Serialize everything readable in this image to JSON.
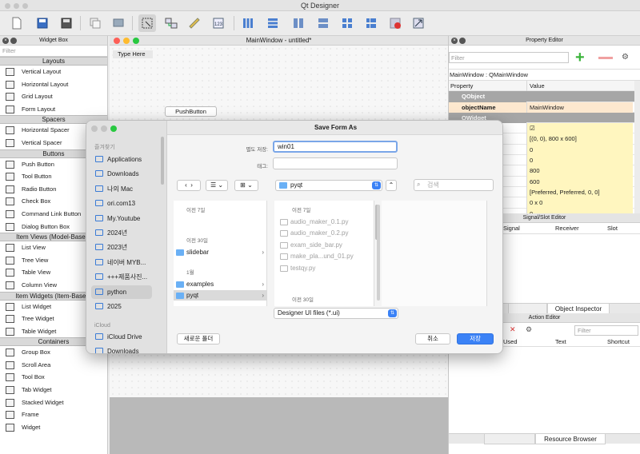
{
  "app": {
    "title": "Qt Designer"
  },
  "toolbar": {
    "buttons": [
      "new-form-icon",
      "save-icon",
      "save-as-icon",
      "copy-icon",
      "layers-icon",
      "edit-widgets-icon",
      "edit-signals-icon",
      "edit-buddies-icon",
      "edit-tab-order-icon",
      "lay-out-horizontally-icon",
      "lay-out-vertically-icon",
      "splitter-h-icon",
      "splitter-v-icon",
      "grid-layout-icon",
      "form-layout-icon",
      "break-layout-icon",
      "adjust-size-icon"
    ]
  },
  "widget_box": {
    "title": "Widget Box",
    "filter_placeholder": "Filter",
    "categories": [
      {
        "label": "Layouts",
        "items": [
          "Vertical Layout",
          "Horizontal Layout",
          "Grid Layout",
          "Form Layout"
        ]
      },
      {
        "label": "Spacers",
        "items": [
          "Horizontal Spacer",
          "Vertical Spacer"
        ]
      },
      {
        "label": "Buttons",
        "items": [
          "Push Button",
          "Tool Button",
          "Radio Button",
          "Check Box",
          "Command Link Button",
          "Dialog Button Box"
        ]
      },
      {
        "label": "Item Views (Model-Based)",
        "items": [
          "List View",
          "Tree View",
          "Table View",
          "Column View"
        ]
      },
      {
        "label": "Item Widgets (Item-Based)",
        "items": [
          "List Widget",
          "Tree Widget",
          "Table Widget"
        ]
      },
      {
        "label": "Containers",
        "items": [
          "Group Box",
          "Scroll Area",
          "Tool Box",
          "Tab Widget",
          "Stacked Widget",
          "Frame",
          "Widget"
        ]
      }
    ]
  },
  "form": {
    "title": "MainWindow - untitled*",
    "menubar_placeholder": "Type Here",
    "push_button": "PushButton"
  },
  "property_editor": {
    "title": "Property Editor",
    "filter_placeholder": "Filter",
    "object_label": "MainWindow : QMainWindow",
    "col_property": "Property",
    "col_value": "Value",
    "rows": [
      {
        "kind": "group",
        "name": "QObject",
        "value": ""
      },
      {
        "kind": "peach",
        "name": "objectName",
        "value": "MainWindow"
      },
      {
        "kind": "group",
        "name": "QWidget",
        "value": ""
      },
      {
        "kind": "yellow",
        "name": "",
        "value": "☑"
      },
      {
        "kind": "yellow",
        "name": "",
        "value": "[(0, 0), 800 x 600]"
      },
      {
        "kind": "yellow",
        "name": "",
        "value": "0"
      },
      {
        "kind": "yellow",
        "name": "",
        "value": "0"
      },
      {
        "kind": "yellow",
        "name": "",
        "value": "800"
      },
      {
        "kind": "yellow",
        "name": "",
        "value": "600"
      },
      {
        "kind": "yellow",
        "name": "",
        "value": "[Preferred, Preferred, 0, 0]"
      },
      {
        "kind": "yellow",
        "name": "",
        "value": "0 x 0"
      },
      {
        "kind": "yellow",
        "name": "",
        "value": "0"
      }
    ]
  },
  "signal_slot_editor": {
    "title": "Signal/Slot Editor",
    "columns": [
      "Signal",
      "Receiver",
      "Slot"
    ],
    "tabs": [
      "",
      "Object Inspector"
    ]
  },
  "action_editor": {
    "title": "Action Editor",
    "filter_placeholder": "Filter",
    "columns": [
      "Used",
      "Text",
      "Shortcut"
    ],
    "tabs": [
      "",
      "Resource Browser"
    ]
  },
  "dialog": {
    "title": "Save Form As",
    "save_as_label": "별도 저장:",
    "save_as_value": "win01",
    "tags_label": "태그:",
    "tags_value": "",
    "view_mode": "☰ ⌄",
    "grid_mode": "⊞ ⌄",
    "location": "pyqt",
    "search_placeholder": "검색",
    "sidebar": {
      "favorites_header": "즐겨찾기",
      "favorites": [
        "Applications",
        "Downloads",
        "나의 Mac",
        "ori.com13",
        "My.Youtube",
        "2024년",
        "2023년",
        "네이버 MYB...",
        "+++제품사진...",
        "python",
        "2025"
      ],
      "selected": "python",
      "icloud_header": "iCloud",
      "icloud": [
        "iCloud Drive",
        "Downloads"
      ]
    },
    "column1": {
      "sections": [
        {
          "header": "이전 7일",
          "items": []
        },
        {
          "header": "이전 30일",
          "items": [
            {
              "name": "slidebar",
              "chevron": true
            }
          ]
        },
        {
          "header": "1월",
          "items": [
            {
              "name": "examples",
              "chevron": true
            },
            {
              "name": "pyqt",
              "chevron": true,
              "selected": true
            }
          ]
        }
      ]
    },
    "column2": {
      "header": "이전 7일",
      "files": [
        "audio_maker_0.1.py",
        "audio_maker_0.2.py",
        "exam_side_bar.py",
        "make_pla...und_01.py",
        "testqy.py"
      ],
      "footer_header": "이전 30일"
    },
    "format_popup": "Designer UI files (*.ui)",
    "new_folder_button": "새로운 폴더",
    "cancel_button": "취소",
    "save_button": "저장"
  }
}
